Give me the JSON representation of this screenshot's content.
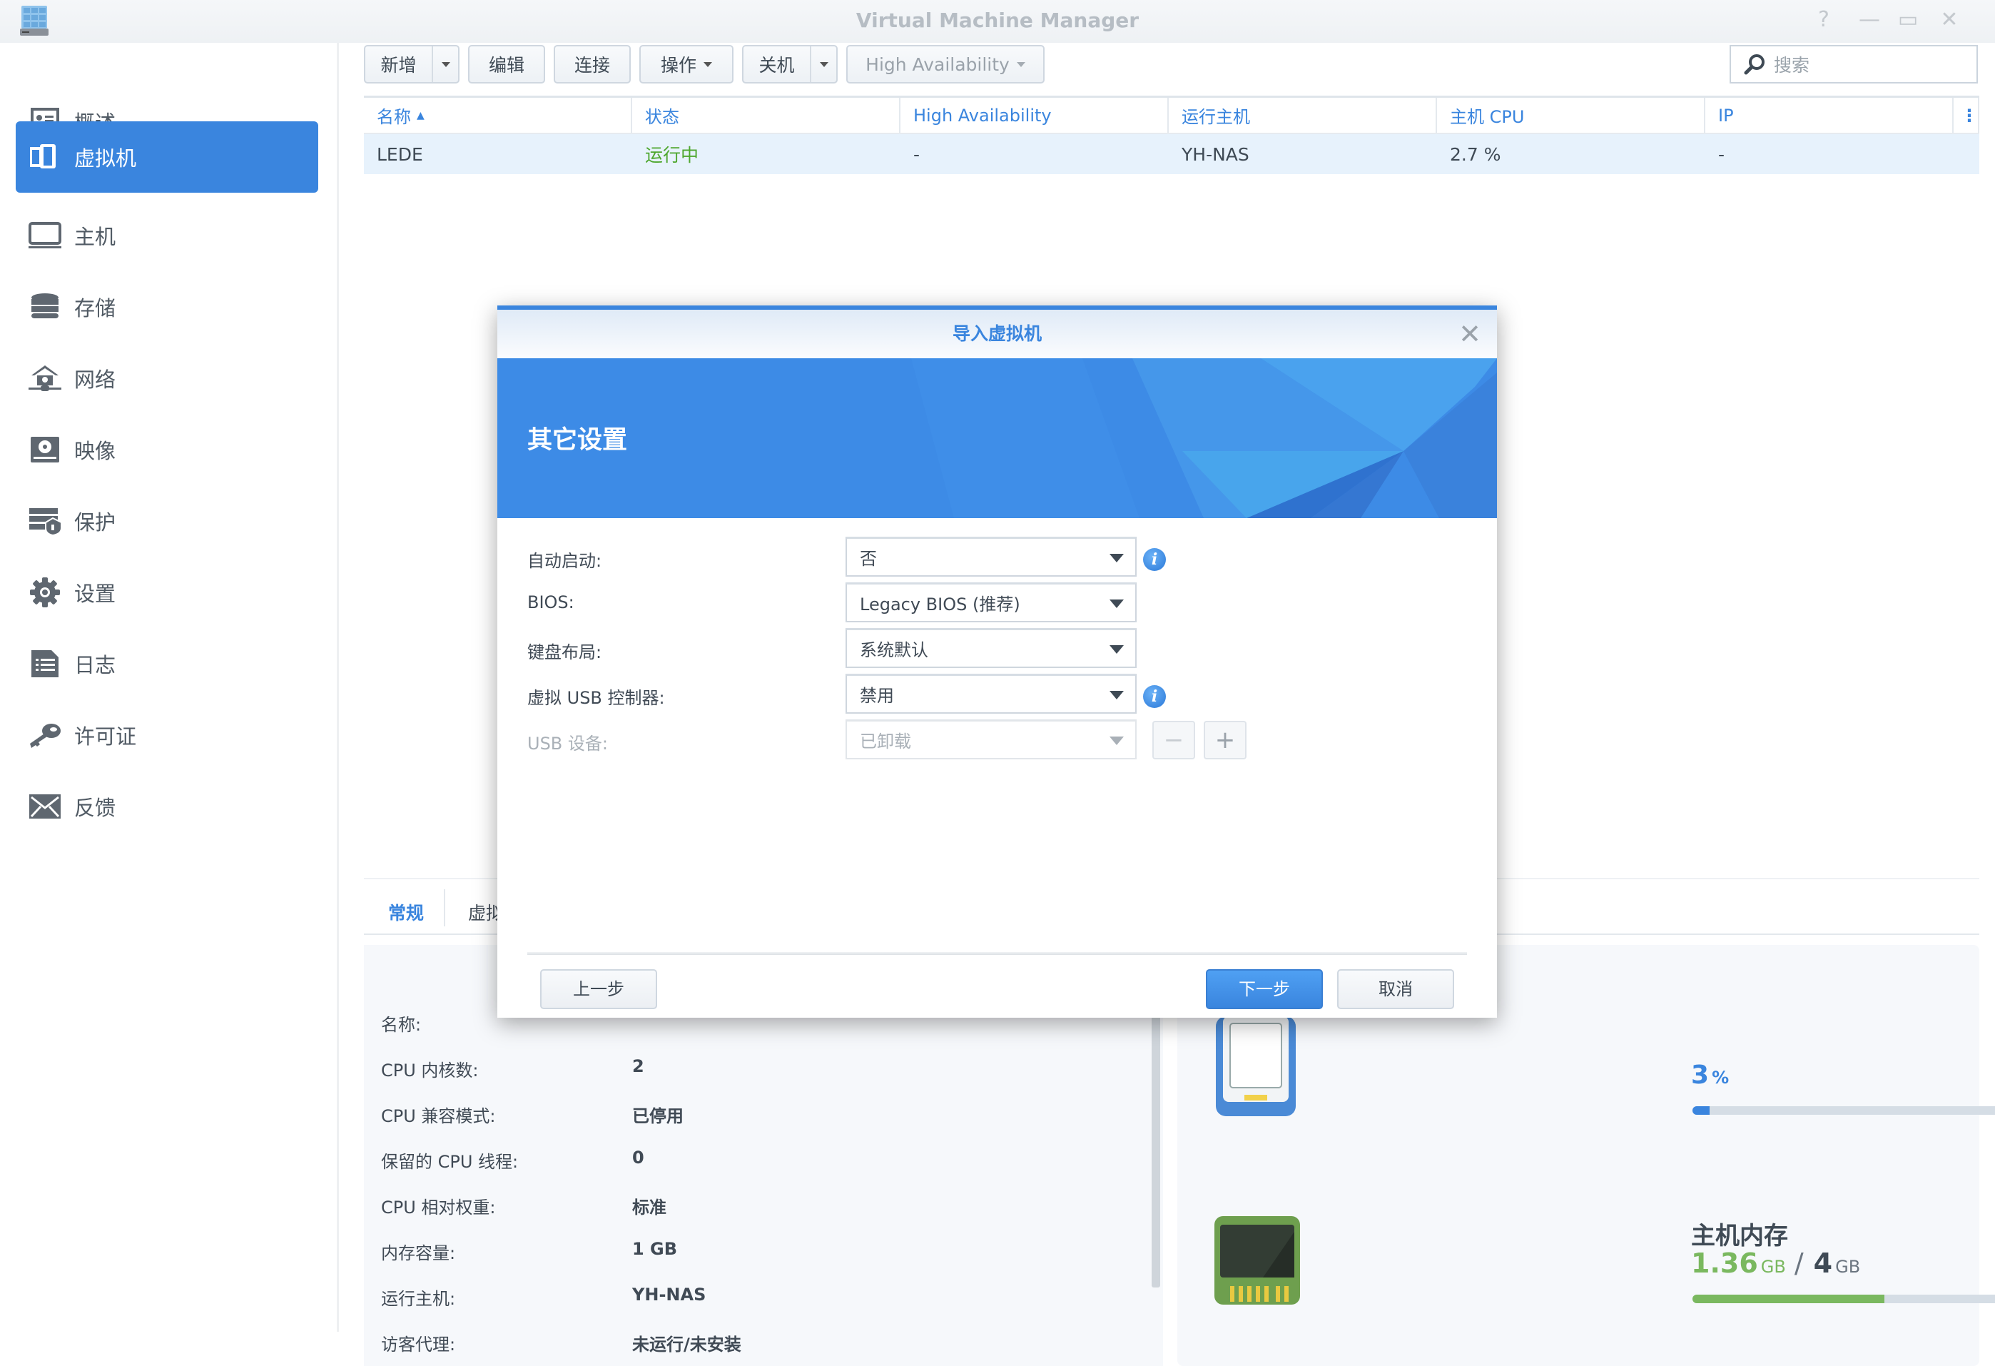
{
  "window": {
    "title": "Virtual Machine Manager",
    "controls": {
      "help": "?",
      "minimize": "—",
      "maximize": "▭",
      "close": "✕"
    }
  },
  "sidebar": {
    "items": [
      {
        "label": "概述",
        "icon": "overview-icon",
        "active": false
      },
      {
        "label": "虚拟机",
        "icon": "virtual-machine-icon",
        "active": true
      },
      {
        "label": "主机",
        "icon": "host-icon",
        "active": false
      },
      {
        "label": "存储",
        "icon": "storage-icon",
        "active": false
      },
      {
        "label": "网络",
        "icon": "network-icon",
        "active": false
      },
      {
        "label": "映像",
        "icon": "image-icon",
        "active": false
      },
      {
        "label": "保护",
        "icon": "protection-icon",
        "active": false
      },
      {
        "label": "设置",
        "icon": "gear-icon",
        "active": false
      },
      {
        "label": "日志",
        "icon": "log-icon",
        "active": false
      },
      {
        "label": "许可证",
        "icon": "key-icon",
        "active": false
      },
      {
        "label": "反馈",
        "icon": "mail-icon",
        "active": false
      }
    ]
  },
  "toolbar": {
    "create": "新增",
    "edit": "编辑",
    "connect": "连接",
    "action": "操作",
    "shutdown": "关机",
    "high_availability": "High Availability",
    "search_placeholder": "搜索"
  },
  "grid": {
    "columns": [
      "名称",
      "状态",
      "High Availability",
      "运行主机",
      "主机 CPU",
      "IP"
    ],
    "sort_indicator": "▲",
    "rows": [
      {
        "name": "LEDE",
        "status": "运行中",
        "ha": "-",
        "host": "YH-NAS",
        "cpu": "2.7 %",
        "ip": "-"
      }
    ]
  },
  "bottom_tabs": [
    "常规",
    "虚拟"
  ],
  "details": [
    {
      "label": "名称:",
      "value": ""
    },
    {
      "label": "CPU 内核数:",
      "value": "2"
    },
    {
      "label": "CPU 兼容模式:",
      "value": "已停用"
    },
    {
      "label": "保留的 CPU 线程:",
      "value": "0"
    },
    {
      "label": "CPU 相对权重:",
      "value": "标准"
    },
    {
      "label": "内存容量:",
      "value": "1 GB"
    },
    {
      "label": "运行主机:",
      "value": "YH-NAS"
    },
    {
      "label": "访客代理:",
      "value": "未运行/未安装"
    }
  ],
  "stats": {
    "cpu": {
      "value": "3",
      "unit": "%",
      "percent": 3,
      "color": "#3a85de"
    },
    "memory": {
      "title": "主机内存",
      "used": "1.36",
      "used_unit": "GB",
      "sep": "/",
      "total": "4",
      "total_unit": "GB",
      "percent": 34,
      "color": "#7ab85f"
    }
  },
  "dialog": {
    "title": "导入虚拟机",
    "banner_title": "其它设置",
    "fields": [
      {
        "label": "自动启动:",
        "value": "否",
        "info": true,
        "disabled": false
      },
      {
        "label": "BIOS:",
        "value": "Legacy BIOS (推荐)",
        "info": false,
        "disabled": false
      },
      {
        "label": "键盘布局:",
        "value": "系统默认",
        "info": false,
        "disabled": false
      },
      {
        "label": "虚拟 USB 控制器:",
        "value": "禁用",
        "info": true,
        "disabled": false
      },
      {
        "label": "USB 设备:",
        "value": "已卸载",
        "info": false,
        "disabled": true
      }
    ],
    "remove_label": "−",
    "add_label": "+",
    "prev": "上一步",
    "next": "下一步",
    "cancel": "取消"
  }
}
